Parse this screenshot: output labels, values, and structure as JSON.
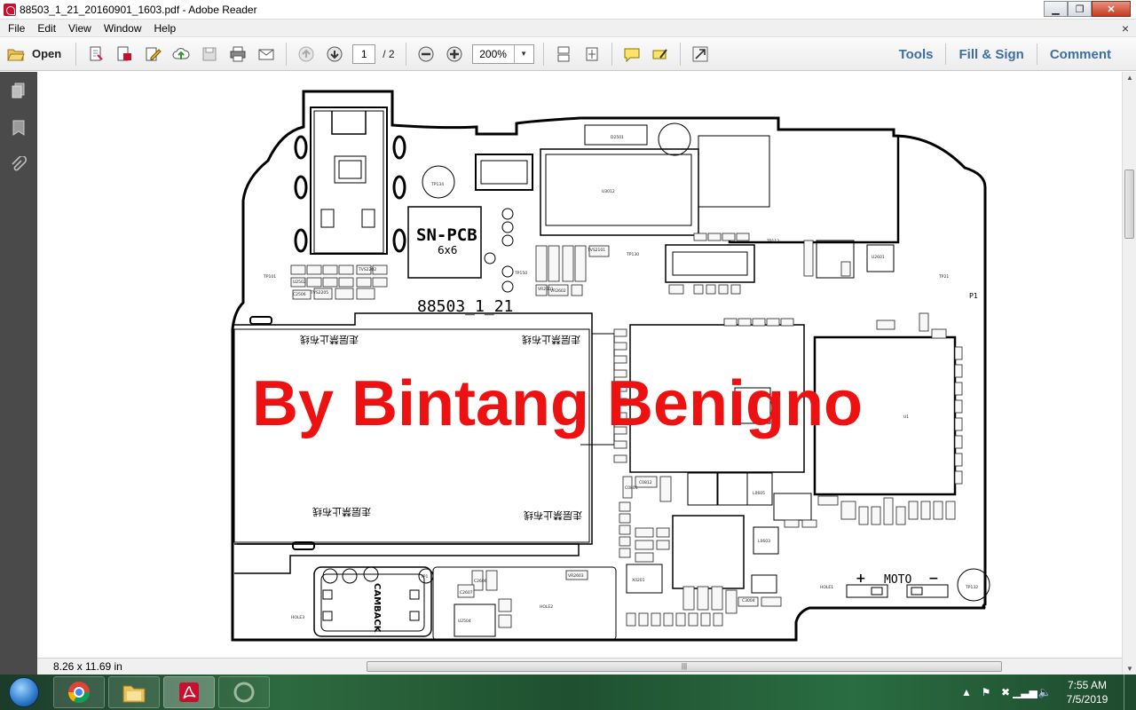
{
  "window": {
    "title": "88503_1_21_20160901_1603.pdf - Adobe Reader",
    "doc_close": "×"
  },
  "menu": [
    "File",
    "Edit",
    "View",
    "Window",
    "Help"
  ],
  "toolbar": {
    "open_label": "Open",
    "page_current": "1",
    "page_total": "/ 2",
    "zoom": "200%",
    "tools_label": "Tools",
    "fill_sign_label": "Fill & Sign",
    "comment_label": "Comment"
  },
  "document": {
    "board_code": "88503_1_21",
    "chip_label": "SN-PCB",
    "chip_size": "6x6",
    "watermark": "By Bintang Benigno",
    "cn_label": "走层禁止布线",
    "moto_label": "MOTO",
    "moto_plus": "+",
    "moto_minus": "−",
    "camback_label": "CAMBACK",
    "p1_label": "P1",
    "tp_labels": [
      "TP134",
      "TP101",
      "TP130",
      "TP112",
      "TP132",
      "TP1",
      "TP21",
      "TP150"
    ],
    "comp_labels": [
      "U2601",
      "D2501",
      "U3012",
      "C2506",
      "U2502",
      "TVS2205",
      "TVS2202",
      "TVS2101",
      "U1",
      "U2",
      "L0605",
      "L0603",
      "X0201",
      "C3004",
      "C0801",
      "C0812",
      "U2504",
      "HOLE1",
      "HOLE2",
      "HOLE3",
      "VR2603",
      "C2606",
      "C2607",
      "VR2601",
      "VR2602"
    ]
  },
  "status": {
    "page_size": "8.26 x 11.69 in"
  },
  "taskbar": {
    "time": "7:55 AM",
    "date": "7/5/2019"
  },
  "colors": {
    "watermark": "#ee1111",
    "link": "#3d6fa3",
    "nav_pane": "#4a4a4a"
  }
}
